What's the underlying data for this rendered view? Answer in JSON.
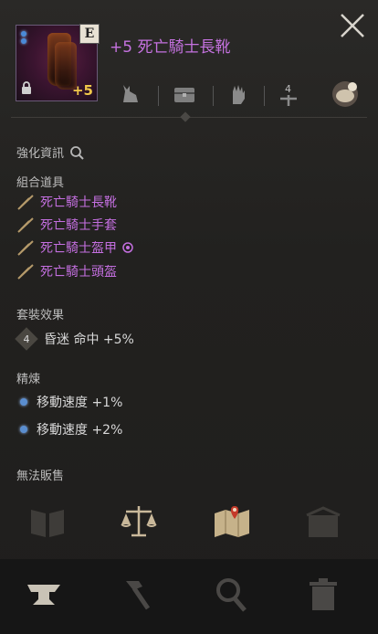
{
  "item": {
    "title": "+5 死亡騎士長靴",
    "grade": "E",
    "enhancement": "+5"
  },
  "sections": {
    "enhance_info": "強化資訊",
    "combo_label": "組合道具",
    "set_effect_label": "套裝效果",
    "refine_label": "精煉",
    "cannot_sell": "無法販售"
  },
  "combo_items": [
    {
      "name": "死亡騎士長靴"
    },
    {
      "name": "死亡騎士手套"
    },
    {
      "name": "死亡騎士盔甲",
      "has_marker": true
    },
    {
      "name": "死亡騎士頭盔"
    }
  ],
  "set_effect": {
    "count": "4",
    "text": "昏迷 命中 +5%"
  },
  "refine_stats": [
    {
      "text": "移動速度 +1%"
    },
    {
      "text": "移動速度 +2%"
    }
  ],
  "colors": {
    "title": "#c572e0",
    "combo_text": "#c46fe0",
    "enhance": "#f0c84a"
  },
  "icons": {
    "top_tools": [
      "rabbit-icon",
      "chest-icon",
      "glove-icon",
      "sword-level-icon",
      "gold-bag-icon"
    ],
    "actions_row": [
      "book-icon",
      "scales-icon",
      "map-icon",
      "box-icon"
    ],
    "footer": [
      "anvil-icon",
      "hammer-icon",
      "magnifier-icon",
      "trash-icon"
    ]
  },
  "top_tools_level": "4"
}
